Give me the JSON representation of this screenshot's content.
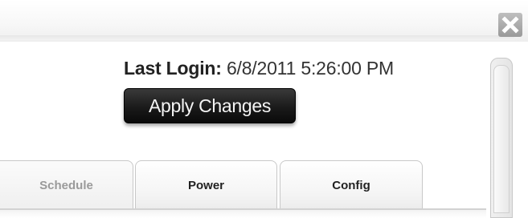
{
  "header": {
    "close_icon": "close-icon"
  },
  "status": {
    "last_login_label": "Last Login:",
    "last_login_value": "6/8/2011 5:26:00 PM"
  },
  "actions": {
    "apply_label": "Apply Changes"
  },
  "tabs": [
    {
      "label": "Schedule",
      "state": "inactive"
    },
    {
      "label": "Power",
      "state": "normal"
    },
    {
      "label": "Config",
      "state": "normal"
    }
  ],
  "colors": {
    "apply_button_bg": "#1a1a1a",
    "apply_button_text": "#f4f4f4",
    "inactive_tab_text": "#9a9a9a"
  }
}
